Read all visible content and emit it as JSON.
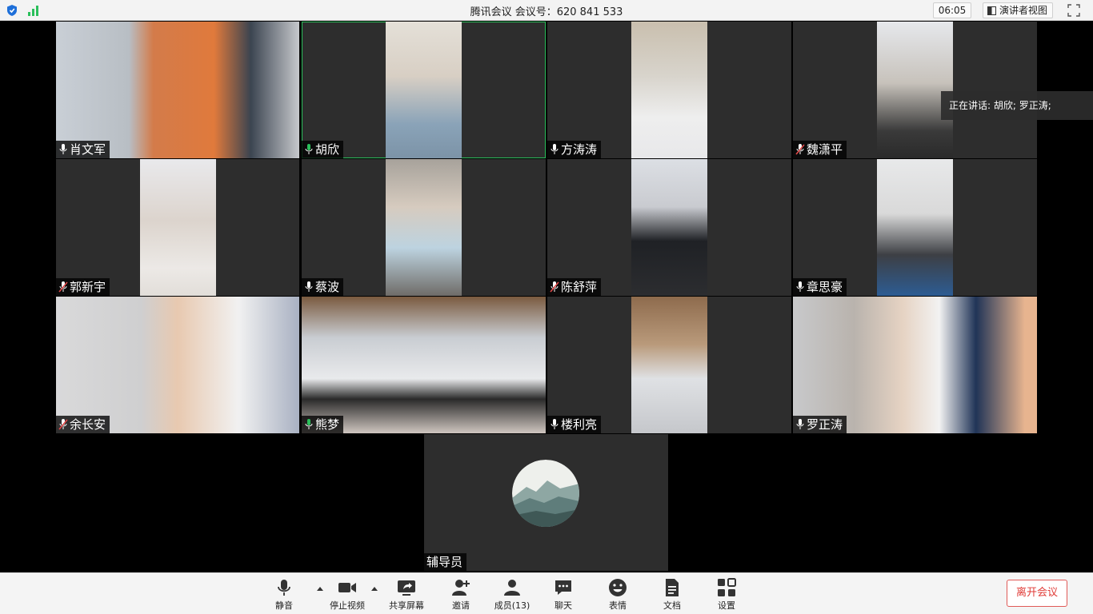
{
  "titlebar": {
    "title": "腾讯会议 会议号：620 841 533",
    "clock": "06:05",
    "view_button": "演讲者视图"
  },
  "speaking": "正在讲话: 胡欣; 罗正涛;",
  "participants": [
    {
      "name": "肖文军",
      "mic": "on"
    },
    {
      "name": "胡欣",
      "mic": "speaking"
    },
    {
      "name": "方涛涛",
      "mic": "on"
    },
    {
      "name": "魏潇平",
      "mic": "muted"
    },
    {
      "name": "郭新宇",
      "mic": "muted"
    },
    {
      "name": "蔡波",
      "mic": "on"
    },
    {
      "name": "陈舒萍",
      "mic": "muted"
    },
    {
      "name": "章思豪",
      "mic": "on"
    },
    {
      "name": "余长安",
      "mic": "muted"
    },
    {
      "name": "熊梦",
      "mic": "speaking"
    },
    {
      "name": "楼利亮",
      "mic": "on"
    },
    {
      "name": "罗正涛",
      "mic": "on"
    },
    {
      "name": "辅导员",
      "mic": "none"
    }
  ],
  "toolbar": {
    "mute": "静音",
    "stop_video": "停止视频",
    "share": "共享屏幕",
    "invite": "邀请",
    "members": "成员(13)",
    "chat": "聊天",
    "reactions": "表情",
    "docs": "文档",
    "settings": "设置",
    "leave": "离开会议"
  },
  "colors": {
    "active_outline": "#2bbf5b",
    "leave_text": "#e03b37",
    "muted_mic": "#e04848",
    "speaking_mic": "#2bbf5b"
  }
}
